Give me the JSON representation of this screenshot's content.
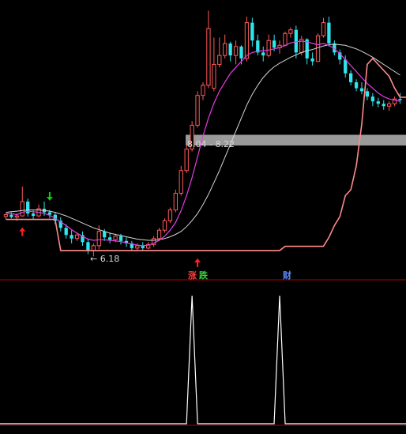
{
  "colors": {
    "background": "#000000",
    "up": "#ff5a5a",
    "down": "#2ee6ee",
    "ma_fast": "#e23ee2",
    "ma_slow": "#d6d6d6",
    "support": "#ff8a8a",
    "indicator": "#ffffff",
    "divider": "#b00000",
    "band": "#9a9a9a",
    "arrow_up": "#ff2020",
    "arrow_down": "#10cc10",
    "tag_zhang": "#ff3a3a",
    "tag_die": "#3ad23a",
    "tag_cai": "#5a8cff"
  },
  "labels": {
    "low_marker": "← 6.18",
    "range_band": "8.04 - 8.22",
    "tag_zhang": "涨",
    "tag_die": "跌",
    "tag_cai": "财"
  },
  "chart_data": [
    {
      "type": "candlestick",
      "title": "",
      "ylim": [
        6.0,
        10.4
      ],
      "candles": [
        [
          6.85,
          6.9,
          6.8,
          6.88
        ],
        [
          6.88,
          6.92,
          6.82,
          6.84
        ],
        [
          6.84,
          6.9,
          6.78,
          6.86
        ],
        [
          6.86,
          7.35,
          6.85,
          7.1
        ],
        [
          7.1,
          7.15,
          6.85,
          6.9
        ],
        [
          6.9,
          6.95,
          6.8,
          6.86
        ],
        [
          6.86,
          7.05,
          6.84,
          6.98
        ],
        [
          6.98,
          7.1,
          6.86,
          6.92
        ],
        [
          6.92,
          6.96,
          6.82,
          6.88
        ],
        [
          6.88,
          6.92,
          6.72,
          6.78
        ],
        [
          6.78,
          6.84,
          6.6,
          6.66
        ],
        [
          6.66,
          6.72,
          6.48,
          6.54
        ],
        [
          6.54,
          6.62,
          6.4,
          6.48
        ],
        [
          6.48,
          6.58,
          6.44,
          6.54
        ],
        [
          6.54,
          6.6,
          6.36,
          6.42
        ],
        [
          6.42,
          6.48,
          6.22,
          6.28
        ],
        [
          6.28,
          6.4,
          6.18,
          6.36
        ],
        [
          6.36,
          6.7,
          6.3,
          6.6
        ],
        [
          6.6,
          6.64,
          6.44,
          6.5
        ],
        [
          6.5,
          6.58,
          6.4,
          6.46
        ],
        [
          6.46,
          6.56,
          6.42,
          6.52
        ],
        [
          6.52,
          6.56,
          6.38,
          6.44
        ],
        [
          6.44,
          6.5,
          6.34,
          6.4
        ],
        [
          6.4,
          6.44,
          6.28,
          6.32
        ],
        [
          6.32,
          6.4,
          6.28,
          6.36
        ],
        [
          6.36,
          6.42,
          6.28,
          6.32
        ],
        [
          6.32,
          6.42,
          6.3,
          6.38
        ],
        [
          6.38,
          6.52,
          6.34,
          6.48
        ],
        [
          6.48,
          6.66,
          6.44,
          6.62
        ],
        [
          6.62,
          6.82,
          6.58,
          6.78
        ],
        [
          6.78,
          7.0,
          6.74,
          6.96
        ],
        [
          6.96,
          7.3,
          6.92,
          7.24
        ],
        [
          7.24,
          7.7,
          7.2,
          7.62
        ],
        [
          7.62,
          8.05,
          7.58,
          7.98
        ],
        [
          7.98,
          8.45,
          7.94,
          8.38
        ],
        [
          8.38,
          8.95,
          8.34,
          8.88
        ],
        [
          8.88,
          9.1,
          8.8,
          9.05
        ],
        [
          9.05,
          10.3,
          9.0,
          10.0
        ],
        [
          9.0,
          9.85,
          8.95,
          9.4
        ],
        [
          9.4,
          9.85,
          9.35,
          9.55
        ],
        [
          9.55,
          9.9,
          9.5,
          9.75
        ],
        [
          9.75,
          9.78,
          9.45,
          9.55
        ],
        [
          9.55,
          9.8,
          9.4,
          9.7
        ],
        [
          9.7,
          9.72,
          9.4,
          9.5
        ],
        [
          9.5,
          10.2,
          9.45,
          10.1
        ],
        [
          10.1,
          10.18,
          9.7,
          9.8
        ],
        [
          9.8,
          9.9,
          9.55,
          9.6
        ],
        [
          9.6,
          9.7,
          9.45,
          9.55
        ],
        [
          9.55,
          9.9,
          9.52,
          9.8
        ],
        [
          9.8,
          9.9,
          9.62,
          9.68
        ],
        [
          9.68,
          9.8,
          9.58,
          9.72
        ],
        [
          9.72,
          9.95,
          9.7,
          9.92
        ],
        [
          9.92,
          10.02,
          9.85,
          9.98
        ],
        [
          9.98,
          10.05,
          9.5,
          9.6
        ],
        [
          9.6,
          9.88,
          9.55,
          9.82
        ],
        [
          9.82,
          9.84,
          9.4,
          9.5
        ],
        [
          9.5,
          9.6,
          9.38,
          9.45
        ],
        [
          9.45,
          9.92,
          9.44,
          9.88
        ],
        [
          9.88,
          10.18,
          9.85,
          10.1
        ],
        [
          10.1,
          10.2,
          9.7,
          9.75
        ],
        [
          9.75,
          9.8,
          9.55,
          9.6
        ],
        [
          9.6,
          9.65,
          9.4,
          9.48
        ],
        [
          9.48,
          9.55,
          9.18,
          9.25
        ],
        [
          9.25,
          9.3,
          9.05,
          9.1
        ],
        [
          9.1,
          9.15,
          8.95,
          9.0
        ],
        [
          9.0,
          9.1,
          8.9,
          8.95
        ],
        [
          8.95,
          9.0,
          8.8,
          8.86
        ],
        [
          8.86,
          8.92,
          8.7,
          8.78
        ],
        [
          8.78,
          8.84,
          8.68,
          8.74
        ],
        [
          8.74,
          8.8,
          8.64,
          8.7
        ],
        [
          8.7,
          8.78,
          8.62,
          8.74
        ],
        [
          8.74,
          8.86,
          8.7,
          8.82
        ],
        [
          8.82,
          8.92,
          8.74,
          8.8
        ]
      ],
      "ma_fast": [
        6.9,
        6.9,
        6.88,
        6.92,
        6.94,
        6.93,
        6.92,
        6.9,
        6.87,
        6.82,
        6.76,
        6.7,
        6.63,
        6.57,
        6.52,
        6.47,
        6.45,
        6.46,
        6.46,
        6.45,
        6.44,
        6.43,
        6.41,
        6.39,
        6.37,
        6.36,
        6.37,
        6.4,
        6.45,
        6.52,
        6.62,
        6.75,
        6.95,
        7.2,
        7.5,
        7.85,
        8.2,
        8.5,
        8.75,
        8.95,
        9.1,
        9.25,
        9.35,
        9.45,
        9.55,
        9.6,
        9.62,
        9.63,
        9.64,
        9.66,
        9.68,
        9.72,
        9.76,
        9.78,
        9.79,
        9.78,
        9.75,
        9.73,
        9.75,
        9.72,
        9.66,
        9.58,
        9.48,
        9.38,
        9.28,
        9.18,
        9.08,
        9.0,
        8.92,
        8.86,
        8.82,
        8.8,
        8.78
      ],
      "ma_slow": [
        6.92,
        6.93,
        6.94,
        6.95,
        6.96,
        6.96,
        6.96,
        6.95,
        6.94,
        6.92,
        6.89,
        6.86,
        6.82,
        6.78,
        6.74,
        6.7,
        6.66,
        6.63,
        6.6,
        6.57,
        6.55,
        6.53,
        6.51,
        6.49,
        6.47,
        6.46,
        6.45,
        6.45,
        6.46,
        6.48,
        6.51,
        6.55,
        6.6,
        6.68,
        6.78,
        6.9,
        7.05,
        7.22,
        7.42,
        7.62,
        7.84,
        8.06,
        8.28,
        8.5,
        8.72,
        8.9,
        9.05,
        9.18,
        9.28,
        9.36,
        9.42,
        9.47,
        9.52,
        9.56,
        9.6,
        9.63,
        9.65,
        9.68,
        9.71,
        9.73,
        9.74,
        9.73,
        9.72,
        9.69,
        9.66,
        9.62,
        9.57,
        9.52,
        9.46,
        9.4,
        9.34,
        9.28,
        9.22
      ],
      "support": [
        6.8,
        6.8,
        6.8,
        6.8,
        6.8,
        6.8,
        6.8,
        6.8,
        6.8,
        6.8,
        6.28,
        6.28,
        6.28,
        6.28,
        6.28,
        6.28,
        6.28,
        6.28,
        6.28,
        6.28,
        6.28,
        6.28,
        6.28,
        6.28,
        6.28,
        6.28,
        6.28,
        6.28,
        6.28,
        6.28,
        6.28,
        6.28,
        6.28,
        6.28,
        6.28,
        6.28,
        6.28,
        6.28,
        6.28,
        6.28,
        6.28,
        6.28,
        6.28,
        6.28,
        6.28,
        6.28,
        6.28,
        6.28,
        6.28,
        6.28,
        6.28,
        6.35,
        6.35,
        6.35,
        6.35,
        6.35,
        6.35,
        6.35,
        6.35,
        6.5,
        6.7,
        6.85,
        7.2,
        7.3,
        7.7,
        8.4,
        9.4,
        9.5,
        9.4,
        9.3,
        9.2,
        9.0,
        8.85,
        8.85,
        8.85,
        8.85
      ],
      "band": [
        8.04,
        8.22
      ],
      "low_value": 6.18,
      "buy_arrows": [
        3,
        35
      ],
      "sell_arrows": [
        8,
        78
      ]
    },
    {
      "type": "line",
      "title": "",
      "ylim": [
        0,
        1
      ],
      "spikes": [
        34,
        50
      ]
    }
  ]
}
